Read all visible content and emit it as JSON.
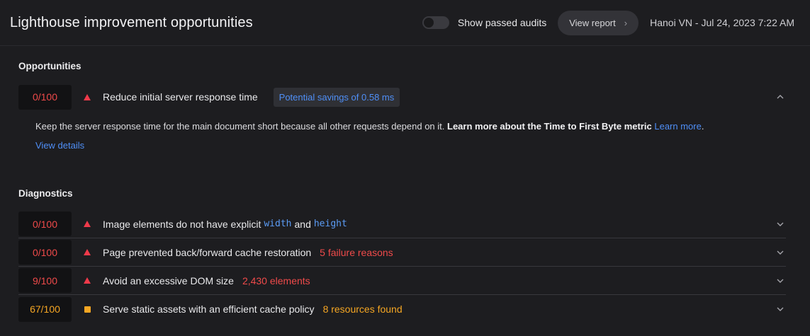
{
  "header": {
    "title": "Lighthouse improvement opportunities",
    "toggle_label": "Show passed audits",
    "view_report_label": "View report",
    "view_report_chevron": "›",
    "meta": "Hanoi VN - Jul 24, 2023 7:22 AM"
  },
  "opportunities": {
    "section_title": "Opportunities",
    "items": [
      {
        "score": "0/100",
        "severity": "fail",
        "title": "Reduce initial server response time",
        "savings": "Potential savings of 0.58 ms",
        "description_text": "Keep the server response time for the main document short because all other requests depend on it. ",
        "description_bold": "Learn more about the Time to First Byte metric",
        "description_link": "Learn more",
        "description_end": ".",
        "view_details": "View details",
        "expanded": true
      }
    ]
  },
  "diagnostics": {
    "section_title": "Diagnostics",
    "items": [
      {
        "score": "0/100",
        "severity": "fail",
        "title_part1": "Image elements do not have explicit",
        "code1": "width",
        "title_part2": "and",
        "code2": "height"
      },
      {
        "score": "0/100",
        "severity": "fail",
        "title": "Page prevented back/forward cache restoration",
        "extra": "5 failure reasons"
      },
      {
        "score": "9/100",
        "severity": "fail",
        "title": "Avoid an excessive DOM size",
        "extra": "2,430 elements"
      },
      {
        "score": "67/100",
        "severity": "average",
        "title": "Serve static assets with an efficient cache policy",
        "extra": "8 resources found"
      }
    ]
  },
  "colors": {
    "background": "#1d1d20",
    "fail": "#ef4a4a",
    "average": "#f5a623",
    "link": "#4f8ff7"
  },
  "icons": {
    "fail": "triangle-icon",
    "average": "square-icon",
    "expand": "chevron-down-icon",
    "collapse": "chevron-up-icon"
  }
}
